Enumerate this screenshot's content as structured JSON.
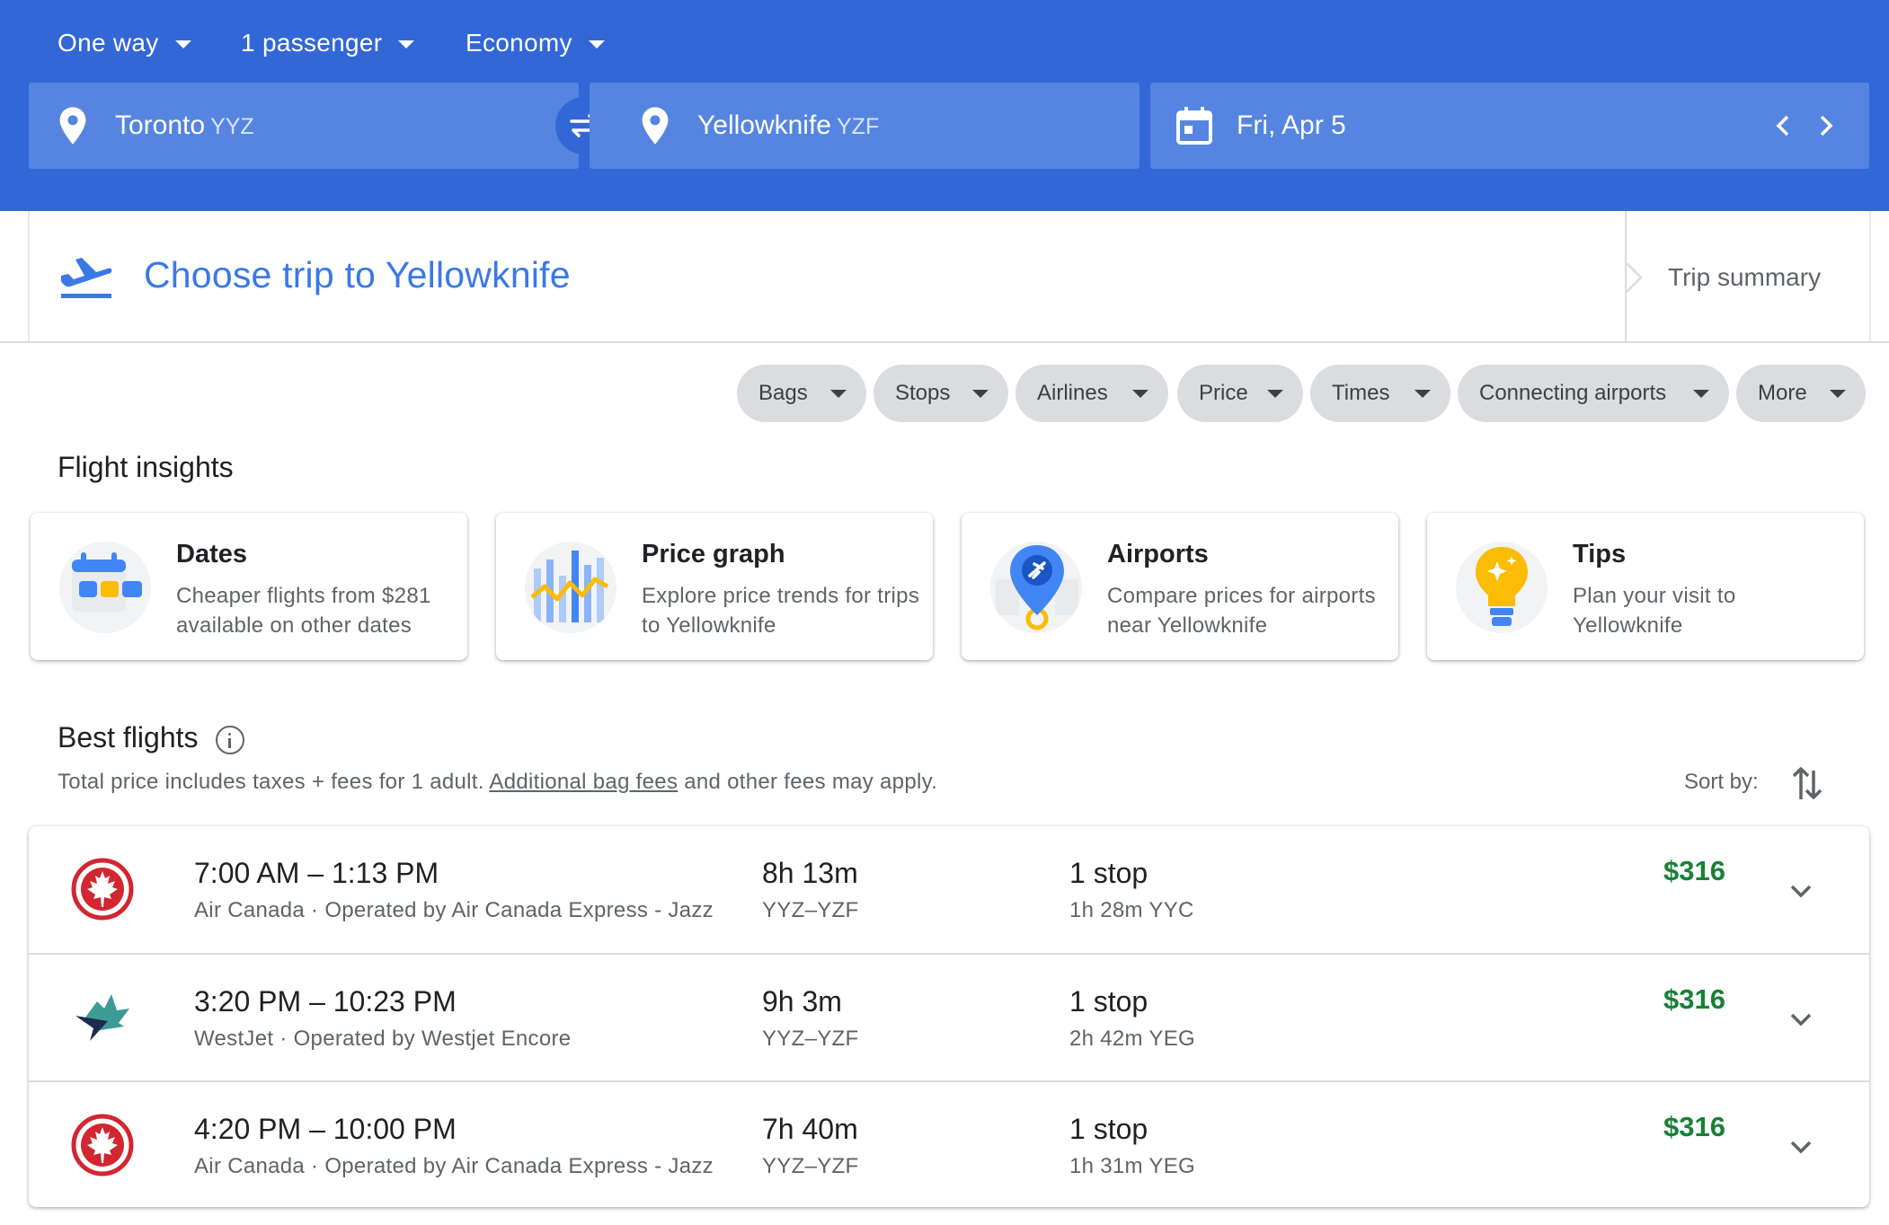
{
  "header": {
    "trip_type": "One way",
    "passengers": "1 passenger",
    "cabin_class": "Economy",
    "origin": {
      "city": "Toronto",
      "code": "YYZ"
    },
    "destination": {
      "city": "Yellowknife",
      "code": "YZF"
    },
    "date": "Fri, Apr 5"
  },
  "trip": {
    "title": "Choose trip to Yellowknife",
    "summary_label": "Trip summary"
  },
  "filters": [
    "Bags",
    "Stops",
    "Airlines",
    "Price",
    "Times",
    "Connecting airports",
    "More"
  ],
  "insights": {
    "title": "Flight insights",
    "cards": [
      {
        "title": "Dates",
        "desc": "Cheaper flights from $281 available on other dates",
        "icon": "calendar-dates-icon"
      },
      {
        "title": "Price graph",
        "desc": "Explore price trends for trips to Yellowknife",
        "icon": "price-graph-icon"
      },
      {
        "title": "Airports",
        "desc": "Compare prices for airports near Yellowknife",
        "icon": "airport-pin-icon"
      },
      {
        "title": "Tips",
        "desc": "Plan your visit to Yellowknife",
        "icon": "lightbulb-icon"
      }
    ]
  },
  "best": {
    "title": "Best flights",
    "note_prefix": "Total price includes taxes + fees for 1 adult.",
    "note_link": "Additional bag fees",
    "note_suffix": "and other fees may apply.",
    "sort_label": "Sort by:"
  },
  "flights": [
    {
      "times": "7:00 AM – 1:13 PM",
      "airline": "Air Canada",
      "operator": "Operated by Air Canada Express - Jazz",
      "duration": "8h 13m",
      "route": "YYZ–YZF",
      "stops": "1 stop",
      "layover": "1h 28m YYC",
      "price": "$316",
      "logo": "air-canada-logo"
    },
    {
      "times": "3:20 PM – 10:23 PM",
      "airline": "WestJet",
      "operator": "Operated by Westjet Encore",
      "duration": "9h 3m",
      "route": "YYZ–YZF",
      "stops": "1 stop",
      "layover": "2h 42m YEG",
      "price": "$316",
      "logo": "westjet-logo"
    },
    {
      "times": "4:20 PM – 10:00 PM",
      "airline": "Air Canada",
      "operator": "Operated by Air Canada Express - Jazz",
      "duration": "7h 40m",
      "route": "YYZ–YZF",
      "stops": "1 stop",
      "layover": "1h 31m YEG",
      "price": "$316",
      "logo": "air-canada-logo"
    }
  ],
  "colors": {
    "header_bg": "#3367d6",
    "field_bg": "#5585e1",
    "accent_blue": "#3b78e7",
    "price_green": "#188038",
    "chip_bg": "#dadce0",
    "air_canada_red": "#d22630",
    "westjet_teal": "#3d9b95",
    "westjet_navy": "#1b2a4e"
  }
}
